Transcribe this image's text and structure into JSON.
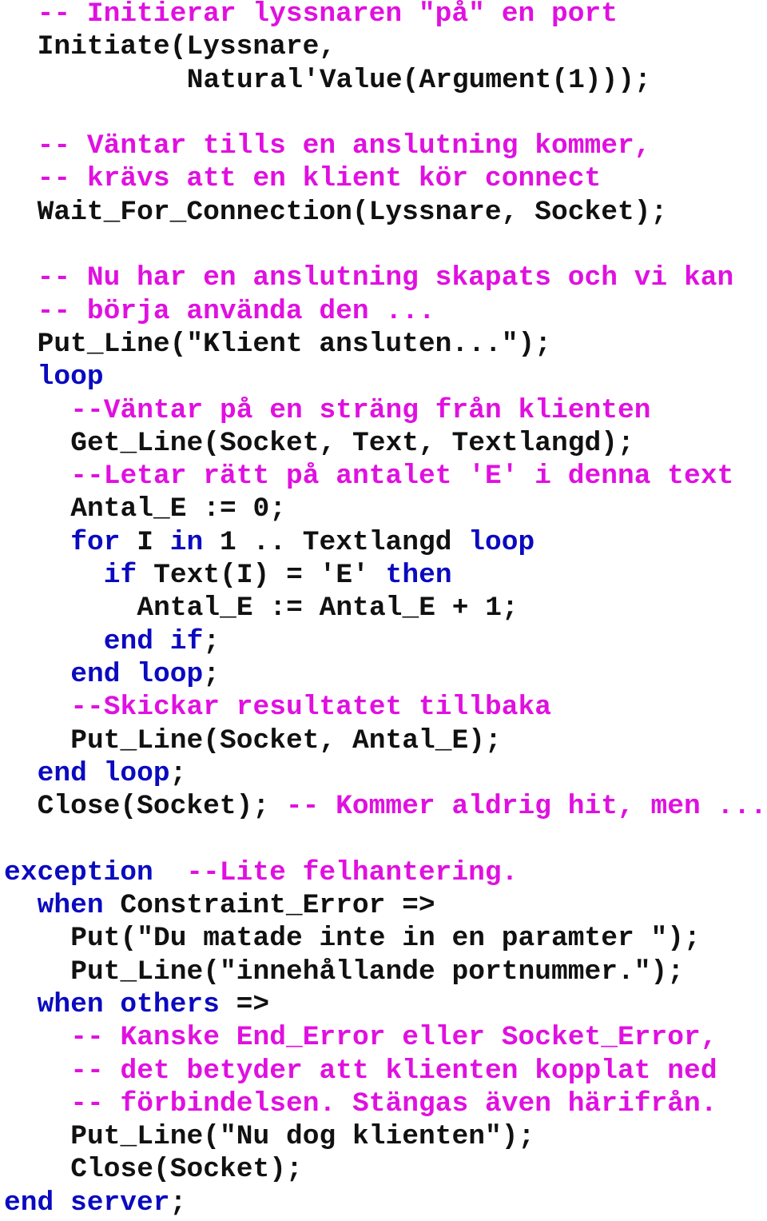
{
  "colors": {
    "comment": "#e010e0",
    "keyword": "#0a0ac0",
    "code": "#111111",
    "background": "#ffffff"
  },
  "lines": [
    {
      "indent": 2,
      "tokens": [
        {
          "t": "comment",
          "v": "-- Initierar lyssnaren ″på″ en port"
        }
      ]
    },
    {
      "indent": 2,
      "tokens": [
        {
          "t": "code",
          "v": "Initiate(Lyssnare,"
        }
      ]
    },
    {
      "indent": 11,
      "tokens": [
        {
          "t": "code",
          "v": "Natural′Value(Argument(1)));"
        }
      ]
    },
    {
      "indent": 0,
      "tokens": []
    },
    {
      "indent": 2,
      "tokens": [
        {
          "t": "comment",
          "v": "-- Väntar tills en anslutning kommer,"
        }
      ]
    },
    {
      "indent": 2,
      "tokens": [
        {
          "t": "comment",
          "v": "-- krävs att en klient kör connect"
        }
      ]
    },
    {
      "indent": 2,
      "tokens": [
        {
          "t": "code",
          "v": "Wait_For_Connection(Lyssnare, Socket);"
        }
      ]
    },
    {
      "indent": 0,
      "tokens": []
    },
    {
      "indent": 2,
      "tokens": [
        {
          "t": "comment",
          "v": "-- Nu har en anslutning skapats och vi kan"
        }
      ]
    },
    {
      "indent": 2,
      "tokens": [
        {
          "t": "comment",
          "v": "-- börja använda den ..."
        }
      ]
    },
    {
      "indent": 2,
      "tokens": [
        {
          "t": "code",
          "v": "Put_Line(\"Klient ansluten...\");"
        }
      ]
    },
    {
      "indent": 2,
      "tokens": [
        {
          "t": "keyword",
          "v": "loop"
        }
      ]
    },
    {
      "indent": 4,
      "tokens": [
        {
          "t": "comment",
          "v": "--Väntar på en sträng från klienten"
        }
      ]
    },
    {
      "indent": 4,
      "tokens": [
        {
          "t": "code",
          "v": "Get_Line(Socket, Text, Textlangd);"
        }
      ]
    },
    {
      "indent": 4,
      "tokens": [
        {
          "t": "comment",
          "v": "--Letar rätt på antalet ′E′ i denna text"
        }
      ]
    },
    {
      "indent": 4,
      "tokens": [
        {
          "t": "code",
          "v": "Antal_E := 0;"
        }
      ]
    },
    {
      "indent": 4,
      "tokens": [
        {
          "t": "keyword",
          "v": "for"
        },
        {
          "t": "code",
          "v": " I "
        },
        {
          "t": "keyword",
          "v": "in"
        },
        {
          "t": "code",
          "v": " 1 .. Textlangd "
        },
        {
          "t": "keyword",
          "v": "loop"
        }
      ]
    },
    {
      "indent": 6,
      "tokens": [
        {
          "t": "keyword",
          "v": "if"
        },
        {
          "t": "code",
          "v": " Text(I) = ′E′ "
        },
        {
          "t": "keyword",
          "v": "then"
        }
      ]
    },
    {
      "indent": 8,
      "tokens": [
        {
          "t": "code",
          "v": "Antal_E := Antal_E + 1;"
        }
      ]
    },
    {
      "indent": 6,
      "tokens": [
        {
          "t": "keyword",
          "v": "end if"
        },
        {
          "t": "code",
          "v": ";"
        }
      ]
    },
    {
      "indent": 4,
      "tokens": [
        {
          "t": "keyword",
          "v": "end loop"
        },
        {
          "t": "code",
          "v": ";"
        }
      ]
    },
    {
      "indent": 4,
      "tokens": [
        {
          "t": "comment",
          "v": "--Skickar resultatet tillbaka"
        }
      ]
    },
    {
      "indent": 4,
      "tokens": [
        {
          "t": "code",
          "v": "Put_Line(Socket, Antal_E);"
        }
      ]
    },
    {
      "indent": 2,
      "tokens": [
        {
          "t": "keyword",
          "v": "end loop"
        },
        {
          "t": "code",
          "v": ";"
        }
      ]
    },
    {
      "indent": 2,
      "tokens": [
        {
          "t": "code",
          "v": "Close(Socket); "
        },
        {
          "t": "comment",
          "v": "-- Kommer aldrig hit, men ..."
        }
      ]
    },
    {
      "indent": 0,
      "tokens": []
    },
    {
      "indent": 0,
      "tokens": [
        {
          "t": "keyword",
          "v": "exception"
        },
        {
          "t": "code",
          "v": "  "
        },
        {
          "t": "comment",
          "v": "--Lite felhantering."
        }
      ]
    },
    {
      "indent": 2,
      "tokens": [
        {
          "t": "keyword",
          "v": "when"
        },
        {
          "t": "code",
          "v": " Constraint_Error =>"
        }
      ]
    },
    {
      "indent": 4,
      "tokens": [
        {
          "t": "code",
          "v": "Put(\"Du matade inte in en paramter ″);"
        }
      ]
    },
    {
      "indent": 4,
      "tokens": [
        {
          "t": "code",
          "v": "Put_Line(″innehållande portnummer.\");"
        }
      ]
    },
    {
      "indent": 2,
      "tokens": [
        {
          "t": "keyword",
          "v": "when others"
        },
        {
          "t": "code",
          "v": " =>"
        }
      ]
    },
    {
      "indent": 4,
      "tokens": [
        {
          "t": "comment",
          "v": "-- Kanske End_Error eller Socket_Error,"
        }
      ]
    },
    {
      "indent": 4,
      "tokens": [
        {
          "t": "comment",
          "v": "-- det betyder att klienten kopplat ned"
        }
      ]
    },
    {
      "indent": 4,
      "tokens": [
        {
          "t": "comment",
          "v": "-- förbindelsen. Stängas även härifrån."
        }
      ]
    },
    {
      "indent": 4,
      "tokens": [
        {
          "t": "code",
          "v": "Put_Line(\"Nu dog klienten\");"
        }
      ]
    },
    {
      "indent": 4,
      "tokens": [
        {
          "t": "code",
          "v": "Close(Socket);"
        }
      ]
    },
    {
      "indent": 0,
      "tokens": [
        {
          "t": "keyword",
          "v": "end server"
        },
        {
          "t": "code",
          "v": ";"
        }
      ]
    }
  ]
}
